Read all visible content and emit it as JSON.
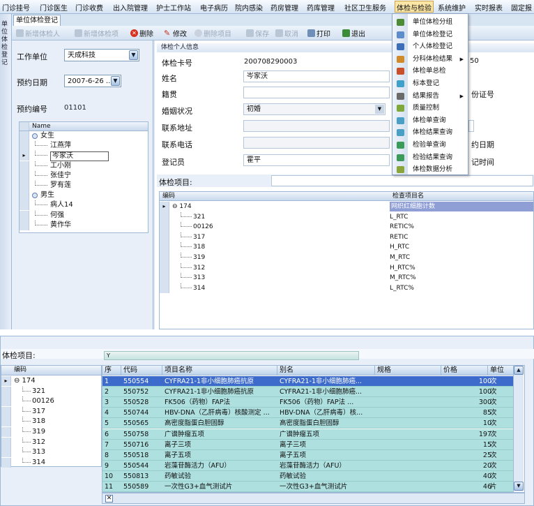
{
  "menu": [
    "门诊挂号",
    "门诊医生",
    "门诊收费",
    "出入院管理",
    "护士工作站",
    "电子病历",
    "院内感染",
    "药房管理",
    "药库管理",
    "社区卫生服务",
    "体检与检验",
    "系统维护",
    "实时报表",
    "固定报"
  ],
  "menu_active_index": 10,
  "side_tab": "单位体检登记",
  "doc_tab": "单位体检登记",
  "toolbar": {
    "new_person": "新增体检人",
    "new_project": "新增体检项",
    "delete": "删除",
    "edit": "修改",
    "delete_item": "删除项目",
    "save": "保存",
    "cancel": "取消",
    "print": "打印",
    "exit": "退出"
  },
  "left": {
    "unit_label": "工作单位",
    "unit_value": "天成科技",
    "date_label": "预约日期",
    "date_value": "2007-6-26 ...",
    "code_label": "预约编号",
    "code_value": "01101",
    "tree_header": "Name",
    "tree": [
      {
        "text": "女生",
        "level": 0
      },
      {
        "text": "江燕萍",
        "level": 1
      },
      {
        "text": "岑家沃",
        "level": 1,
        "selected": true
      },
      {
        "text": "工小刚",
        "level": 1
      },
      {
        "text": "张佳宁",
        "level": 1
      },
      {
        "text": "罗有莲",
        "level": 1
      },
      {
        "text": "男生",
        "level": 0
      },
      {
        "text": "病人14",
        "level": 1
      },
      {
        "text": "何强",
        "level": 1
      },
      {
        "text": "黄作华",
        "level": 1
      }
    ]
  },
  "info": {
    "header": "体检个人信息",
    "card_label": "体检卡号",
    "card_value": "200708290003",
    "name_label": "姓名",
    "name_value": "岑家沃",
    "origin_label": "籍贯",
    "marital_label": "婚姻状况",
    "marital_value": "初婚",
    "address_label": "联系地址",
    "phone_label": "联系电话",
    "registrar_label": "登记员",
    "registrar_value": "霍平",
    "right_frag1": "50",
    "right_frag2": "份证号",
    "right_frag3": "约日期",
    "right_frag4": "记时间"
  },
  "exam_label": "体检项目:",
  "grid2": {
    "headers": [
      "编码",
      "检查项目名"
    ],
    "rows": [
      {
        "code": "174",
        "name": "网织红细胞计数",
        "group": true
      },
      {
        "code": "321",
        "name": "L_RTC"
      },
      {
        "code": "00126",
        "name": "RETIC%"
      },
      {
        "code": "317",
        "name": "RETIC"
      },
      {
        "code": "318",
        "name": "H_RTC"
      },
      {
        "code": "319",
        "name": "M_RTC"
      },
      {
        "code": "312",
        "name": "H_RTC%"
      },
      {
        "code": "313",
        "name": "M_RTC%"
      },
      {
        "code": "314",
        "name": "L_RTC%"
      }
    ]
  },
  "dropdown": [
    {
      "text": "单位体检分组"
    },
    {
      "text": "单位体检登记"
    },
    {
      "text": "个人体检登记"
    },
    {
      "text": "分科体检结果",
      "submenu": true
    },
    {
      "text": "体检单总检"
    },
    {
      "text": "标本登记"
    },
    {
      "text": "结果报告",
      "submenu": true
    },
    {
      "text": "质量控制"
    },
    {
      "text": "体检单查询"
    },
    {
      "text": "体检结果查询"
    },
    {
      "text": "检验单查询"
    },
    {
      "text": "检验结果查询"
    },
    {
      "text": "体检数据分析"
    }
  ],
  "bottom": {
    "exam_label": "体检项目:",
    "filter_text": "Y",
    "tree_header": "编码",
    "tree": [
      "174",
      "321",
      "00126",
      "317",
      "318",
      "319",
      "312",
      "313",
      "314"
    ],
    "headers": [
      "序",
      "代码",
      "项目名称",
      "别名",
      "规格",
      "价格",
      "单位"
    ],
    "rows": [
      [
        "1",
        "550554",
        "CYFRA21-1非小细胞肺癌抗原",
        "CYFRA21-1非小细胞肺癌...",
        "",
        "100",
        "次"
      ],
      [
        "2",
        "550752",
        "CYFRA21-1非小细胞肺癌抗原",
        "CYFRA21-1非小细胞肺癌...",
        "",
        "100",
        "次"
      ],
      [
        "3",
        "550528",
        "FK506（药物）FAP法",
        "FK506（药物）FAP法 ...",
        "",
        "300",
        "次"
      ],
      [
        "4",
        "550744",
        "HBV-DNA（乙肝病毒）核酸测定 ...",
        "HBV-DNA（乙肝病毒）核...",
        "",
        "85",
        "次"
      ],
      [
        "5",
        "550565",
        "高密度脂蛋白胆固醇",
        "高密度脂蛋白胆固醇",
        "",
        "10",
        "次"
      ],
      [
        "6",
        "550758",
        "广谱肿瘤五项",
        "广谱肿瘤五项",
        "",
        "197",
        "次"
      ],
      [
        "7",
        "550716",
        "离子三项",
        "离子三项",
        "",
        "15",
        "次"
      ],
      [
        "8",
        "550518",
        "离子五项",
        "离子五项",
        "",
        "25",
        "次"
      ],
      [
        "9",
        "550544",
        "岩藻苷酶活力（AFU）",
        "岩藻苷酶活力（AFU）",
        "",
        "20",
        "次"
      ],
      [
        "10",
        "550813",
        "药敏试验",
        "药敏试验",
        "",
        "40",
        "次"
      ],
      [
        "11",
        "550589",
        "一次性G3+血气测试片",
        "一次性G3+血气测试片",
        "",
        "46",
        "片"
      ]
    ]
  },
  "colors": {
    "selected_row": "#3d6bcc",
    "list_row": "#aee0e0",
    "menu_active": "#fbe6a6"
  }
}
